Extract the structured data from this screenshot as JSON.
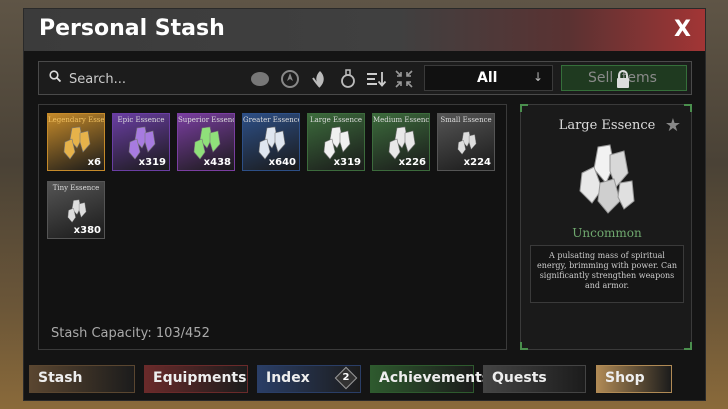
{
  "window": {
    "title": "Personal Stash",
    "close_label": "X"
  },
  "toolbar": {
    "search_placeholder": "Search...",
    "filter_icons": [
      "blob-icon",
      "compass-icon",
      "leaf-icon",
      "potion-icon",
      "sort-icon",
      "collapse-icon"
    ],
    "select_value": "All",
    "sell_label": "Sell Items"
  },
  "items": [
    {
      "name": "Legendary Essence",
      "qty": "x6",
      "color": "#c58a2a",
      "gem": "#e6b24a"
    },
    {
      "name": "Epic Essence",
      "qty": "x319",
      "color": "#6a3ea3",
      "gem": "#a77be0"
    },
    {
      "name": "Superior Essence",
      "qty": "x438",
      "color": "#7a3ea0",
      "gem": "#8fe07a"
    },
    {
      "name": "Greater Essence",
      "qty": "x640",
      "color": "#2d4f86",
      "gem": "#dfe6f0"
    },
    {
      "name": "Large Essence",
      "qty": "x319",
      "color": "#3c6b3c",
      "gem": "#f0f0f0"
    },
    {
      "name": "Medium Essence",
      "qty": "x226",
      "color": "#3c6b3c",
      "gem": "#e8e8e8"
    },
    {
      "name": "Small Essence",
      "qty": "x224",
      "color": "#555555",
      "gem": "#dddddd"
    },
    {
      "name": "Tiny Essence",
      "qty": "x380",
      "color": "#555555",
      "gem": "#dddddd"
    }
  ],
  "capacity": "Stash Capacity: 103/452",
  "detail": {
    "name": "Large Essence",
    "rarity": "Uncommon",
    "description": "A pulsating mass of spiritual energy, brimming with power. Can significantly strengthen weapons and armor."
  },
  "tabs": [
    {
      "label": "Stash",
      "color": "#5a4630"
    },
    {
      "label": "Equipments",
      "color": "#6a2a2a"
    },
    {
      "label": "Index",
      "color": "#2a3e66",
      "badge": "2"
    },
    {
      "label": "Achievements",
      "color": "#2e5a2e"
    },
    {
      "label": "Quests",
      "color": "#444444"
    },
    {
      "label": "Shop",
      "color": "#b08a55"
    }
  ]
}
